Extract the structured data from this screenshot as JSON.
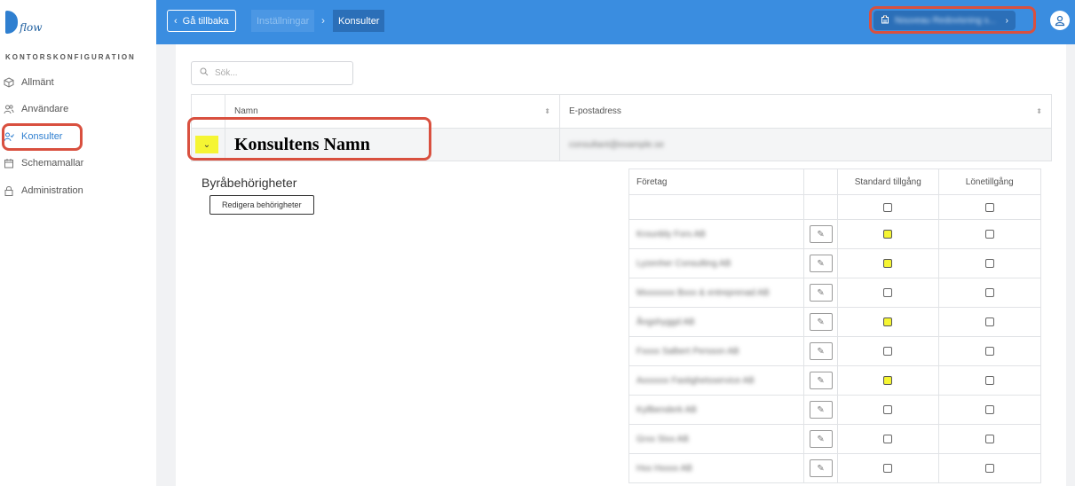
{
  "sidebar": {
    "logo_text": "flow",
    "section_title": "KONTORSKONFIGURATION",
    "items": [
      {
        "label": "Allmänt",
        "icon": "cube-icon"
      },
      {
        "label": "Användare",
        "icon": "users-icon"
      },
      {
        "label": "Konsulter",
        "icon": "consultant-icon",
        "active": true
      },
      {
        "label": "Schemamallar",
        "icon": "calendar-icon"
      },
      {
        "label": "Administration",
        "icon": "lock-icon"
      }
    ]
  },
  "topbar": {
    "back_label": "Gå tillbaka",
    "breadcrumb": [
      "Inställningar",
      "Konsulter"
    ],
    "org_name": "Nouveau Redovisning s...",
    "accent": "#3a8de0"
  },
  "search": {
    "placeholder": "Sök..."
  },
  "grid": {
    "columns": [
      "Namn",
      "E-postadress"
    ],
    "row": {
      "name": "Konsultens Namn",
      "email": "consultant@example.se"
    }
  },
  "permissions": {
    "title": "Byråbehörigheter",
    "edit_button": "Redigera behörigheter",
    "columns": [
      "Företag",
      "Standard tillgång",
      "Lönetillgång"
    ],
    "rows": [
      {
        "company": "",
        "std_highlight": false,
        "has_edit": false
      },
      {
        "company": "Krounbly Fors AB",
        "std_highlight": true,
        "has_edit": true
      },
      {
        "company": "Lyzenher Consulting AB",
        "std_highlight": true,
        "has_edit": true
      },
      {
        "company": "Mxxxxxxx Bxxx & entreprenad AB",
        "std_highlight": false,
        "has_edit": true
      },
      {
        "company": "Ångshyggd AB",
        "std_highlight": true,
        "has_edit": true
      },
      {
        "company": "Fxxxx Salbert Persson AB",
        "std_highlight": false,
        "has_edit": true
      },
      {
        "company": "Axxxxxx Fastighetsservice AB",
        "std_highlight": true,
        "has_edit": true
      },
      {
        "company": "Kyllbenderk AB",
        "std_highlight": false,
        "has_edit": true
      },
      {
        "company": "Grxx Stxx AB",
        "std_highlight": false,
        "has_edit": true
      },
      {
        "company": "Hxx Hxxxx AB",
        "std_highlight": false,
        "has_edit": true
      }
    ]
  },
  "colors": {
    "annotation": "#d9503f",
    "highlight": "#f5f533"
  }
}
